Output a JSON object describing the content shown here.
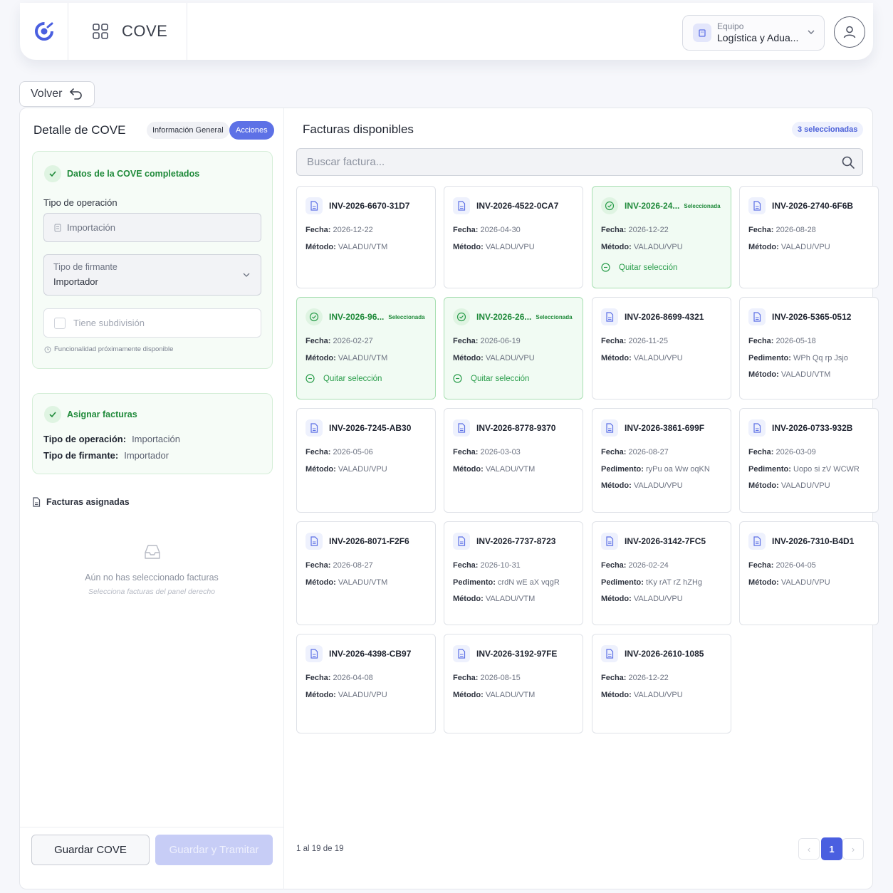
{
  "header": {
    "app_title": "COVE",
    "team_label": "Equipo",
    "team_value": "Logística y Adua...",
    "logo_icon": "cove-logo-icon",
    "apps_icon": "grid-apps-icon",
    "avatar_icon": "user-icon"
  },
  "back_button": {
    "label": "Volver"
  },
  "left": {
    "title": "Detalle de COVE",
    "tabs": [
      {
        "label": "Información General",
        "active": false
      },
      {
        "label": "Acciones",
        "active": true
      }
    ],
    "section_data": {
      "title": "Datos de la COVE completados",
      "operation_label": "Tipo de operación",
      "operation_value": "Importación",
      "signer_label": "Tipo de firmante",
      "signer_value": "Importador",
      "subdivision_label": "Tiene subdivisión",
      "hint": "Funcionalidad próximamente disponible"
    },
    "section_assign": {
      "title": "Asignar facturas",
      "operation_key": "Tipo de operación:",
      "operation_value": "Importación",
      "signer_key": "Tipo de firmante:",
      "signer_value": "Importador"
    },
    "assigned": {
      "title": "Facturas asignadas",
      "empty_text": "Aún no has seleccionado facturas",
      "empty_sub": "Selecciona facturas del panel derecho"
    },
    "buttons": {
      "save": "Guardar COVE",
      "process": "Guardar y Tramitar"
    }
  },
  "right": {
    "title": "Facturas disponibles",
    "selected_badge": "3 seleccionadas",
    "search_placeholder": "Buscar factura...",
    "selected_tag": "Seleccionada",
    "remove_label": "Quitar selección",
    "labels": {
      "fecha": "Fecha:",
      "metodo": "Método:",
      "pedimento": "Pedimento:"
    },
    "invoices": [
      {
        "id": "INV-2026-6670-31D7",
        "fecha": "2026-12-22",
        "metodo": "VALADU/VTM",
        "selected": false
      },
      {
        "id": "INV-2026-4522-0CA7",
        "fecha": "2026-04-30",
        "metodo": "VALADU/VPU",
        "selected": false
      },
      {
        "id": "INV-2026-24...",
        "fecha": "2026-12-22",
        "metodo": "VALADU/VPU",
        "selected": true
      },
      {
        "id": "INV-2026-2740-6F6B",
        "fecha": "2026-08-28",
        "metodo": "VALADU/VPU",
        "selected": false
      },
      {
        "id": "INV-2026-96...",
        "fecha": "2026-02-27",
        "metodo": "VALADU/VTM",
        "selected": true
      },
      {
        "id": "INV-2026-26...",
        "fecha": "2026-06-19",
        "metodo": "VALADU/VPU",
        "selected": true
      },
      {
        "id": "INV-2026-8699-4321",
        "fecha": "2026-11-25",
        "metodo": "VALADU/VPU",
        "selected": false
      },
      {
        "id": "INV-2026-5365-0512",
        "fecha": "2026-05-18",
        "pedimento": "WPh Qq rp Jsjo",
        "metodo": "VALADU/VTM",
        "selected": false
      },
      {
        "id": "INV-2026-7245-AB30",
        "fecha": "2026-05-06",
        "metodo": "VALADU/VPU",
        "selected": false
      },
      {
        "id": "INV-2026-8778-9370",
        "fecha": "2026-03-03",
        "metodo": "VALADU/VTM",
        "selected": false
      },
      {
        "id": "INV-2026-3861-699F",
        "fecha": "2026-08-27",
        "pedimento": "ryPu oa Ww oqKN",
        "metodo": "VALADU/VPU",
        "selected": false
      },
      {
        "id": "INV-2026-0733-932B",
        "fecha": "2026-03-09",
        "pedimento": "Uopo si zV WCWR",
        "metodo": "VALADU/VPU",
        "selected": false
      },
      {
        "id": "INV-2026-8071-F2F6",
        "fecha": "2026-08-27",
        "metodo": "VALADU/VTM",
        "selected": false
      },
      {
        "id": "INV-2026-7737-8723",
        "fecha": "2026-10-31",
        "pedimento": "crdN wE aX vqgR",
        "metodo": "VALADU/VTM",
        "selected": false
      },
      {
        "id": "INV-2026-3142-7FC5",
        "fecha": "2026-02-24",
        "pedimento": "tKy rAT rZ hZHg",
        "metodo": "VALADU/VPU",
        "selected": false
      },
      {
        "id": "INV-2026-7310-B4D1",
        "fecha": "2026-04-05",
        "metodo": "VALADU/VPU",
        "selected": false
      },
      {
        "id": "INV-2026-4398-CB97",
        "fecha": "2026-04-08",
        "metodo": "VALADU/VPU",
        "selected": false
      },
      {
        "id": "INV-2026-3192-97FE",
        "fecha": "2026-08-15",
        "metodo": "VALADU/VTM",
        "selected": false
      },
      {
        "id": "INV-2026-2610-1085",
        "fecha": "2026-12-22",
        "metodo": "VALADU/VPU",
        "selected": false
      }
    ],
    "pagination": {
      "summary": "1 al 19 de 19",
      "prev": "‹",
      "current": "1",
      "next": "›"
    }
  },
  "colors": {
    "accent": "#5d71e6",
    "success": "#1f8a3a",
    "selected_bg": "#f1fbf3"
  }
}
